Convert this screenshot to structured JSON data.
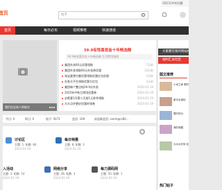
{
  "header": {
    "logo": "首页",
    "search_placeholder": "帖子",
    "top_note": "3D打印中的问题"
  },
  "nav": [
    {
      "label": "首页",
      "active": true
    },
    {
      "label": "每日必买",
      "active": false
    },
    {
      "label": "视频推荐",
      "active": false
    },
    {
      "label": "快速通道",
      "active": false
    }
  ],
  "hero": {
    "caption": "我们在没有人的地方"
  },
  "hot": {
    "title": "39.9有惊喜资金十年畅选精",
    "subtitle": "39.9有惊喜资金十年畅选精 生活费用指南",
    "rows": [
      {
        "text": "美团外卖60元优惠领取",
        "time": "7天前"
      },
      {
        "text": "美团外卖领取60元外卖券优惠",
        "time": "10天前"
      },
      {
        "text": "淘宝要想大额优惠领取优惠红包办理",
        "time": "2天前"
      },
      {
        "text": "在各大平台领取优惠大红包",
        "time": "2天前"
      },
      {
        "text": "美团每个整点抢29.9分外卖",
        "time": "2024-01-19"
      },
      {
        "text": "2025年中秋日常用优惠券",
        "time": "2024-01-19"
      },
      {
        "text": "必胜客1月第二天前1元秒杀领取",
        "time": "2024-01-19"
      },
      {
        "text": "大众点评更好优惠的领券",
        "time": "2024-01-19"
      }
    ]
  },
  "stats": {
    "today": "今日: 0",
    "yesterday": "昨日: 0",
    "posts": "帖子: 5671",
    "members": "会员: 169",
    "newest": "欢迎新会员: seemgce80..."
  },
  "features": [
    {
      "name": "讨论区",
      "meta": "主题: 1, 帖数: 84",
      "date": "2024-01-19"
    },
    {
      "name": "每日特惠",
      "meta": "主题: 8, 帖数: 2",
      "date": "2024-01-19"
    },
    {
      "name": "入活动",
      "meta": "主题: 3, 帖数: 14",
      "date": "2024-01-19"
    },
    {
      "name": "网络分享",
      "meta": "主题: 28, 帖数: 3",
      "date": "2024-01-19"
    },
    {
      "name": "每力源码网",
      "meta": "主题: 50, 帖数: 1",
      "date": "2024-01-19"
    }
  ],
  "sidebar": {
    "btn1": "大家都在搜的网站推荐",
    "btn2": "福利汇总社区",
    "header1": "图文推荐",
    "captions": [
      "小米之家 限时折扣",
      "新手必读帖",
      "限时好价",
      "我的收藏",
      "大众点评到 店优惠"
    ],
    "header2": "热门帖子"
  },
  "colors": {
    "accent": "#e63a30",
    "nav": "#2f2f2f"
  }
}
